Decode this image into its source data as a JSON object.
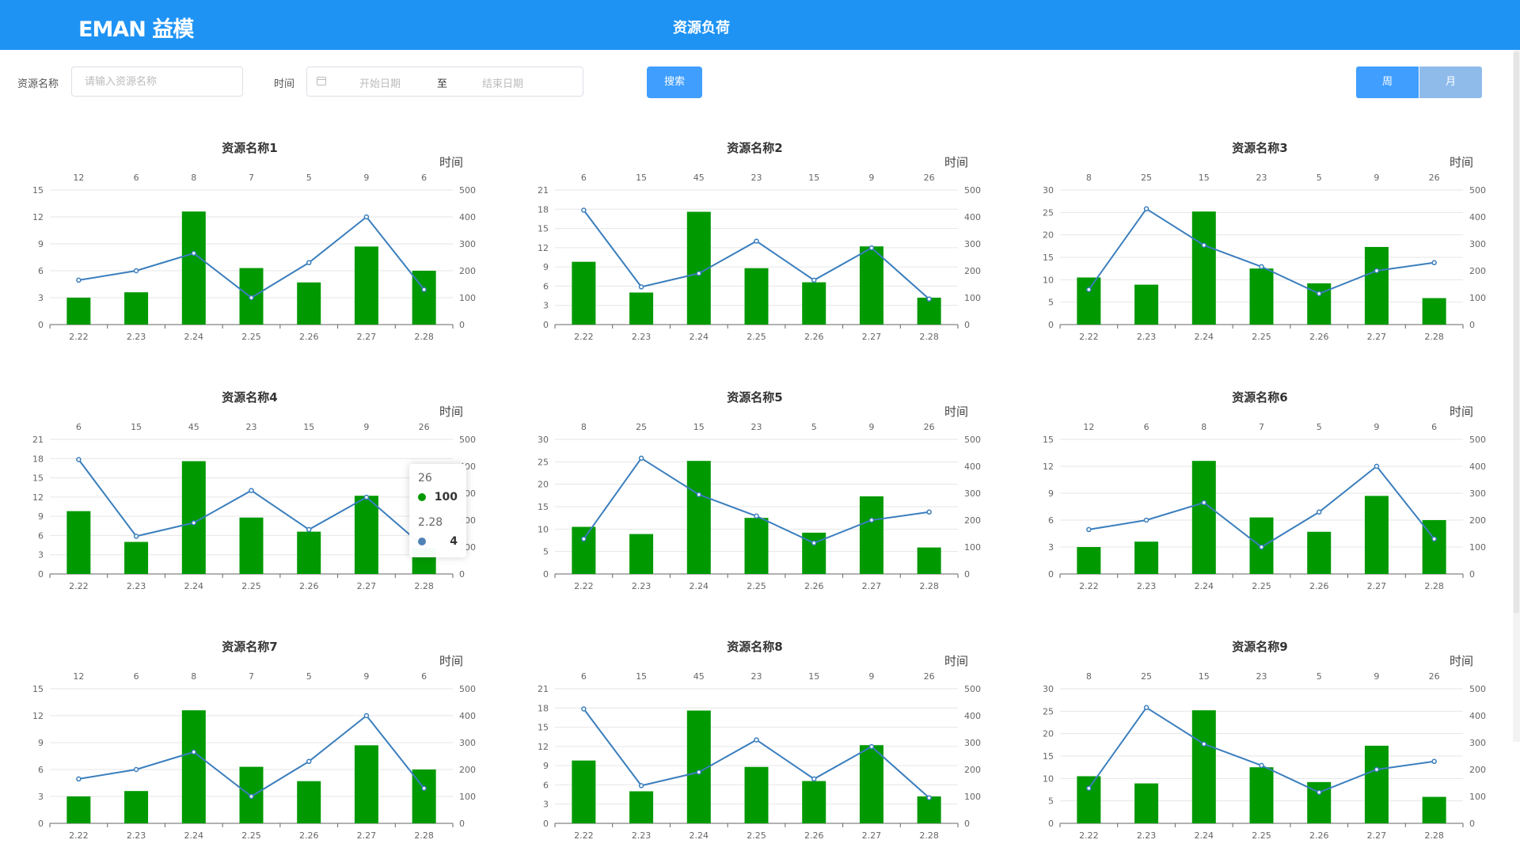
{
  "header": {
    "logo": "EMAN 益模",
    "title": "资源负荷"
  },
  "filters": {
    "resource_label": "资源名称",
    "resource_placeholder": "请输入资源名称",
    "time_label": "时间",
    "start_placeholder": "开始日期",
    "range_separator": "至",
    "end_placeholder": "结束日期",
    "search_button": "搜索",
    "week_button": "周",
    "month_button": "月"
  },
  "colors": {
    "header_bg": "#1e93f4",
    "bar": "#009900",
    "line": "#3a7ebd",
    "primary": "#409eff",
    "month_inactive": "#8fbbeb"
  },
  "tooltip": {
    "line1_title": "26",
    "line1_value": "100",
    "line2_title": "2.28",
    "line2_value": "4"
  },
  "chart_data": [
    {
      "type": "bar",
      "title": "资源名称1",
      "top_axis_name": "时间",
      "categories": [
        "2.22",
        "2.23",
        "2.24",
        "2.25",
        "2.26",
        "2.27",
        "2.28"
      ],
      "top_categories": [
        "12",
        "6",
        "8",
        "7",
        "5",
        "9",
        "6"
      ],
      "left_ylim": [
        0,
        15
      ],
      "left_ticks": [
        0,
        3,
        6,
        9,
        12,
        15
      ],
      "right_ylim": [
        0,
        500
      ],
      "right_ticks": [
        0,
        100,
        200,
        300,
        400,
        500
      ],
      "series": [
        {
          "type": "bar",
          "axis": "left",
          "values": [
            3,
            3.6,
            12.6,
            6.3,
            4.7,
            8.7,
            6
          ]
        },
        {
          "type": "line",
          "axis": "right",
          "values": [
            165,
            200,
            265,
            100,
            230,
            400,
            130
          ]
        }
      ]
    },
    {
      "type": "bar",
      "title": "资源名称2",
      "top_axis_name": "时间",
      "categories": [
        "2.22",
        "2.23",
        "2.24",
        "2.25",
        "2.26",
        "2.27",
        "2.28"
      ],
      "top_categories": [
        "6",
        "15",
        "45",
        "23",
        "15",
        "9",
        "26"
      ],
      "left_ylim": [
        0,
        21
      ],
      "left_ticks": [
        0,
        3,
        6,
        9,
        12,
        15,
        18,
        21
      ],
      "right_ylim": [
        0,
        500
      ],
      "right_ticks": [
        0,
        100,
        200,
        300,
        400,
        500
      ],
      "series": [
        {
          "type": "bar",
          "axis": "left",
          "values": [
            9.8,
            5,
            17.6,
            8.8,
            6.6,
            12.2,
            4.2
          ]
        },
        {
          "type": "line",
          "axis": "right",
          "values": [
            425,
            140,
            190,
            310,
            165,
            285,
            95
          ]
        }
      ]
    },
    {
      "type": "bar",
      "title": "资源名称3",
      "top_axis_name": "时间",
      "categories": [
        "2.22",
        "2.23",
        "2.24",
        "2.25",
        "2.26",
        "2.27",
        "2.28"
      ],
      "top_categories": [
        "8",
        "25",
        "15",
        "23",
        "5",
        "9",
        "26"
      ],
      "left_ylim": [
        0,
        30
      ],
      "left_ticks": [
        0,
        5,
        10,
        15,
        20,
        25,
        30
      ],
      "right_ylim": [
        0,
        500
      ],
      "right_ticks": [
        0,
        100,
        200,
        300,
        400,
        500
      ],
      "series": [
        {
          "type": "bar",
          "axis": "left",
          "values": [
            10.5,
            8.9,
            25.2,
            12.5,
            9.2,
            17.3,
            5.9
          ]
        },
        {
          "type": "line",
          "axis": "right",
          "values": [
            130,
            430,
            295,
            215,
            115,
            200,
            230
          ]
        }
      ]
    },
    {
      "type": "bar",
      "title": "资源名称4",
      "top_axis_name": "时间",
      "categories": [
        "2.22",
        "2.23",
        "2.24",
        "2.25",
        "2.26",
        "2.27",
        "2.28"
      ],
      "top_categories": [
        "6",
        "15",
        "45",
        "23",
        "15",
        "9",
        "26"
      ],
      "left_ylim": [
        0,
        21
      ],
      "left_ticks": [
        0,
        3,
        6,
        9,
        12,
        15,
        18,
        21
      ],
      "right_ylim": [
        0,
        500
      ],
      "right_ticks": [
        0,
        100,
        200,
        300,
        400,
        500
      ],
      "series": [
        {
          "type": "bar",
          "axis": "left",
          "values": [
            9.8,
            5,
            17.6,
            8.8,
            6.6,
            12.2,
            4
          ]
        },
        {
          "type": "line",
          "axis": "right",
          "values": [
            425,
            140,
            190,
            310,
            165,
            285,
            100
          ]
        }
      ]
    },
    {
      "type": "bar",
      "title": "资源名称5",
      "top_axis_name": "时间",
      "categories": [
        "2.22",
        "2.23",
        "2.24",
        "2.25",
        "2.26",
        "2.27",
        "2.28"
      ],
      "top_categories": [
        "8",
        "25",
        "15",
        "23",
        "5",
        "9",
        "26"
      ],
      "left_ylim": [
        0,
        30
      ],
      "left_ticks": [
        0,
        5,
        10,
        15,
        20,
        25,
        30
      ],
      "right_ylim": [
        0,
        500
      ],
      "right_ticks": [
        0,
        100,
        200,
        300,
        400,
        500
      ],
      "series": [
        {
          "type": "bar",
          "axis": "left",
          "values": [
            10.5,
            8.9,
            25.2,
            12.5,
            9.2,
            17.3,
            5.9
          ]
        },
        {
          "type": "line",
          "axis": "right",
          "values": [
            130,
            430,
            295,
            215,
            115,
            200,
            230
          ]
        }
      ]
    },
    {
      "type": "bar",
      "title": "资源名称6",
      "top_axis_name": "时间",
      "categories": [
        "2.22",
        "2.23",
        "2.24",
        "2.25",
        "2.26",
        "2.27",
        "2.28"
      ],
      "top_categories": [
        "12",
        "6",
        "8",
        "7",
        "5",
        "9",
        "6"
      ],
      "left_ylim": [
        0,
        15
      ],
      "left_ticks": [
        0,
        3,
        6,
        9,
        12,
        15
      ],
      "right_ylim": [
        0,
        500
      ],
      "right_ticks": [
        0,
        100,
        200,
        300,
        400,
        500
      ],
      "series": [
        {
          "type": "bar",
          "axis": "left",
          "values": [
            3,
            3.6,
            12.6,
            6.3,
            4.7,
            8.7,
            6
          ]
        },
        {
          "type": "line",
          "axis": "right",
          "values": [
            165,
            200,
            265,
            100,
            230,
            400,
            130
          ]
        }
      ]
    },
    {
      "type": "bar",
      "title": "资源名称7",
      "top_axis_name": "时间",
      "categories": [
        "2.22",
        "2.23",
        "2.24",
        "2.25",
        "2.26",
        "2.27",
        "2.28"
      ],
      "top_categories": [
        "12",
        "6",
        "8",
        "7",
        "5",
        "9",
        "6"
      ],
      "left_ylim": [
        0,
        15
      ],
      "left_ticks": [
        0,
        3,
        6,
        9,
        12,
        15
      ],
      "right_ylim": [
        0,
        500
      ],
      "right_ticks": [
        0,
        100,
        200,
        300,
        400,
        500
      ],
      "series": [
        {
          "type": "bar",
          "axis": "left",
          "values": [
            3,
            3.6,
            12.6,
            6.3,
            4.7,
            8.7,
            6
          ]
        },
        {
          "type": "line",
          "axis": "right",
          "values": [
            165,
            200,
            265,
            100,
            230,
            400,
            130
          ]
        }
      ]
    },
    {
      "type": "bar",
      "title": "资源名称8",
      "top_axis_name": "时间",
      "categories": [
        "2.22",
        "2.23",
        "2.24",
        "2.25",
        "2.26",
        "2.27",
        "2.28"
      ],
      "top_categories": [
        "6",
        "15",
        "45",
        "23",
        "15",
        "9",
        "26"
      ],
      "left_ylim": [
        0,
        21
      ],
      "left_ticks": [
        0,
        3,
        6,
        9,
        12,
        15,
        18,
        21
      ],
      "right_ylim": [
        0,
        500
      ],
      "right_ticks": [
        0,
        100,
        200,
        300,
        400,
        500
      ],
      "series": [
        {
          "type": "bar",
          "axis": "left",
          "values": [
            9.8,
            5,
            17.6,
            8.8,
            6.6,
            12.2,
            4.2
          ]
        },
        {
          "type": "line",
          "axis": "right",
          "values": [
            425,
            140,
            190,
            310,
            165,
            285,
            95
          ]
        }
      ]
    },
    {
      "type": "bar",
      "title": "资源名称9",
      "top_axis_name": "时间",
      "categories": [
        "2.22",
        "2.23",
        "2.24",
        "2.25",
        "2.26",
        "2.27",
        "2.28"
      ],
      "top_categories": [
        "8",
        "25",
        "15",
        "23",
        "5",
        "9",
        "26"
      ],
      "left_ylim": [
        0,
        30
      ],
      "left_ticks": [
        0,
        5,
        10,
        15,
        20,
        25,
        30
      ],
      "right_ylim": [
        0,
        500
      ],
      "right_ticks": [
        0,
        100,
        200,
        300,
        400,
        500
      ],
      "series": [
        {
          "type": "bar",
          "axis": "left",
          "values": [
            10.5,
            8.9,
            25.2,
            12.5,
            9.2,
            17.3,
            5.9
          ]
        },
        {
          "type": "line",
          "axis": "right",
          "values": [
            130,
            430,
            295,
            215,
            115,
            200,
            230
          ]
        }
      ]
    }
  ]
}
